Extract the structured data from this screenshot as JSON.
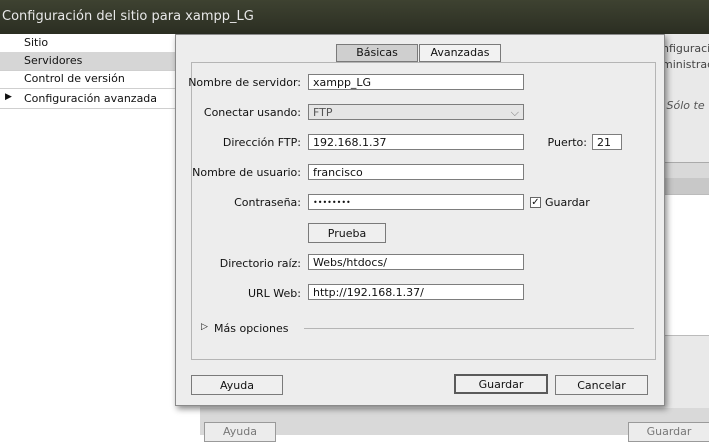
{
  "window": {
    "title": "Configuración del sitio para xampp_LG"
  },
  "sidebar": {
    "items": [
      {
        "label": "Sitio",
        "selected": false,
        "expandable": false
      },
      {
        "label": "Servidores",
        "selected": true,
        "expandable": false
      },
      {
        "label": "Control de versión",
        "selected": false,
        "expandable": false
      },
      {
        "label": "Configuración avanzada",
        "selected": false,
        "expandable": true
      }
    ]
  },
  "background": {
    "text_line1": "nfiguraci",
    "text_line2": "ministrac",
    "text_line3": "r. Sólo te",
    "help_button": "Ayuda",
    "save_button": "Guardar"
  },
  "dialog": {
    "tabs": [
      {
        "label": "Básicas",
        "active": true
      },
      {
        "label": "Avanzadas",
        "active": false
      }
    ],
    "fields": {
      "server_name": {
        "label": "Nombre de servidor:",
        "value": "xampp_LG"
      },
      "connect_using": {
        "label": "Conectar usando:",
        "value": "FTP"
      },
      "ftp_address": {
        "label": "Dirección FTP:",
        "value": "192.168.1.37"
      },
      "port": {
        "label": "Puerto:",
        "value": "21"
      },
      "username": {
        "label": "Nombre de usuario:",
        "value": "francisco"
      },
      "password": {
        "label": "Contraseña:",
        "value": "••••••••"
      },
      "save_password": {
        "label": "Guardar",
        "checked": true
      },
      "root_dir": {
        "label": "Directorio raíz:",
        "value": "Webs/htdocs/"
      },
      "web_url": {
        "label": "URL Web:",
        "value": "http://192.168.1.37/"
      }
    },
    "test_button": "Prueba",
    "more_options": "Más opciones",
    "buttons": {
      "help": "Ayuda",
      "save": "Guardar",
      "cancel": "Cancelar"
    }
  },
  "colors": {
    "titlebar": "#2f3226",
    "selected_nav": "#d6d6d6",
    "dialog_bg": "#ededed"
  }
}
